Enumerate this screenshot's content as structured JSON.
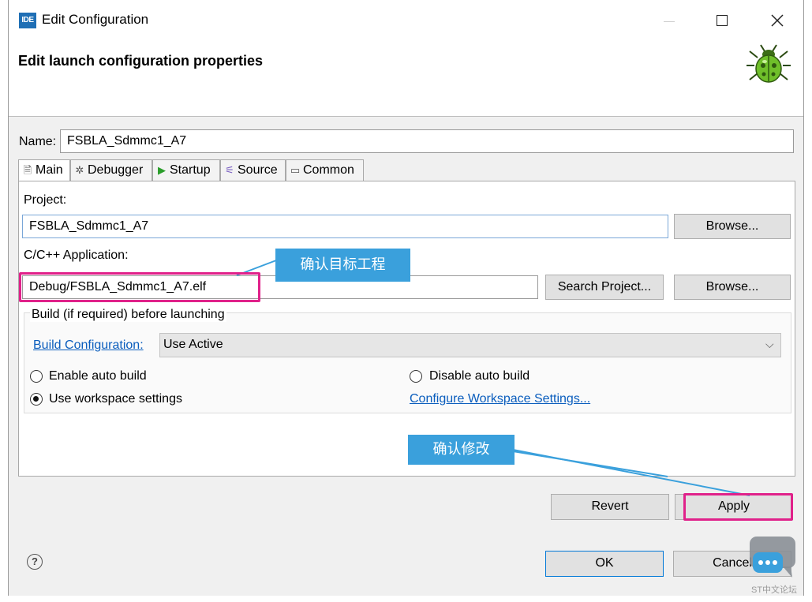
{
  "window": {
    "app_icon_text": "IDE",
    "title": "Edit Configuration",
    "header_title": "Edit launch configuration properties"
  },
  "name_row": {
    "label": "Name:",
    "value": "FSBLA_Sdmmc1_A7"
  },
  "tabs": [
    {
      "label": "Main",
      "icon": "document-icon",
      "icon_glyph": "🗎",
      "active": true
    },
    {
      "label": "Debugger",
      "icon": "bug-gear-icon",
      "icon_glyph": "✲",
      "active": false
    },
    {
      "label": "Startup",
      "icon": "play-icon",
      "icon_glyph": "▶",
      "active": false
    },
    {
      "label": "Source",
      "icon": "source-icon",
      "icon_glyph": "⚟",
      "active": false
    },
    {
      "label": "Common",
      "icon": "window-icon",
      "icon_glyph": "▭",
      "active": false
    }
  ],
  "main": {
    "project_label": "Project:",
    "project_value": "FSBLA_Sdmmc1_A7",
    "project_browse": "Browse...",
    "app_label": "C/C++ Application:",
    "app_value": "Debug/FSBLA_Sdmmc1_A7.elf",
    "search_project": "Search Project...",
    "app_browse": "Browse...",
    "build_group_title": "Build (if required) before launching",
    "build_config_link": "Build Configuration:",
    "build_config_value": "Use Active",
    "radios": {
      "enable_auto_build": "Enable auto build",
      "disable_auto_build": "Disable auto build",
      "use_workspace_settings": "Use workspace settings",
      "selected": "use_workspace_settings"
    },
    "configure_workspace_link": "Configure Workspace Settings..."
  },
  "annotations": {
    "confirm_target_project": "确认目标工程",
    "confirm_modify": "确认修改"
  },
  "buttons": {
    "revert": "Revert",
    "apply": "Apply",
    "ok": "OK",
    "cancel": "Cancel"
  },
  "watermark": "ST中文论坛",
  "colors": {
    "callout_bg": "#3aa0dc",
    "highlight_border": "#e0218a",
    "link": "#0a5dbd",
    "app_icon_bg": "#1f6fb5"
  }
}
